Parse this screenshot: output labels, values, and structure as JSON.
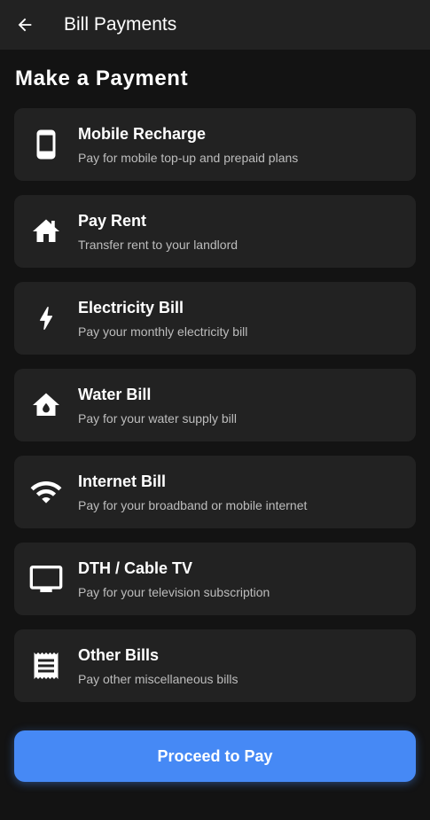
{
  "app_bar": {
    "back_icon": "arrow-back-icon",
    "title": "Bill Payments"
  },
  "section": {
    "title": "Make a Payment"
  },
  "payment_options": [
    {
      "icon": "smartphone-icon",
      "title": "Mobile Recharge",
      "subtitle": "Pay for mobile top-up and prepaid plans"
    },
    {
      "icon": "home-icon",
      "title": "Pay Rent",
      "subtitle": "Transfer rent to your landlord"
    },
    {
      "icon": "bolt-icon",
      "title": "Electricity Bill",
      "subtitle": "Pay your monthly electricity bill"
    },
    {
      "icon": "water-drop-home-icon",
      "title": "Water Bill",
      "subtitle": "Pay for your water supply bill"
    },
    {
      "icon": "wifi-icon",
      "title": "Internet Bill",
      "subtitle": "Pay for your broadband or mobile internet"
    },
    {
      "icon": "tv-icon",
      "title": "DTH / Cable TV",
      "subtitle": "Pay for your television subscription"
    },
    {
      "icon": "receipt-icon",
      "title": "Other Bills",
      "subtitle": "Pay other miscellaneous bills"
    }
  ],
  "proceed_button": {
    "label": "Proceed to Pay"
  },
  "colors": {
    "background": "#131313",
    "surface": "#222222",
    "accent": "#4689f5",
    "text_primary": "#ffffff",
    "text_secondary": "#bdbdbd"
  }
}
